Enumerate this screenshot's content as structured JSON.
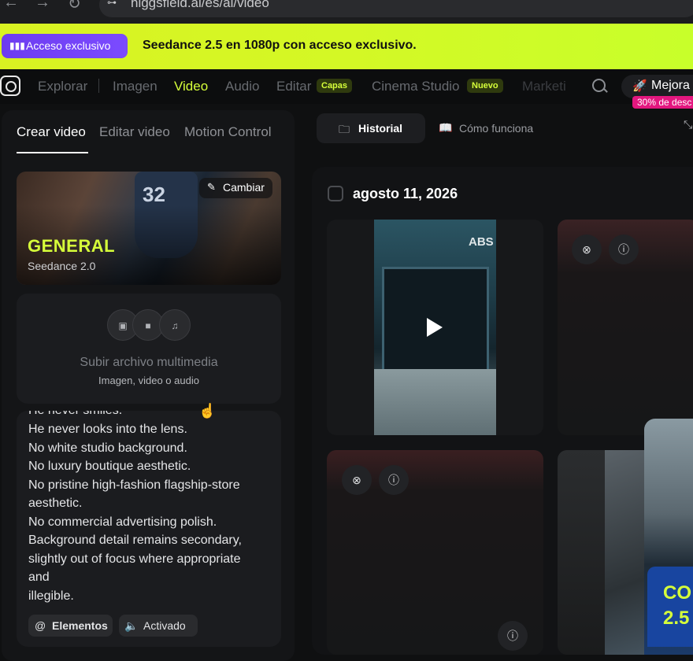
{
  "browser": {
    "back": "←",
    "forward": "→",
    "reload": "↻",
    "url": "higgsfield.ai/es/ai/video"
  },
  "promo": {
    "badge": "Acceso exclusivo",
    "text": "Seedance 2.5 en 1080p con acceso exclusivo."
  },
  "nav": {
    "items": [
      "Explorar",
      "Imagen",
      "Video",
      "Audio",
      "Editar",
      "Cinema Studio",
      "Marketi"
    ],
    "active": "Video",
    "tag_capas": "Capas",
    "tag_nuevo": "Nuevo",
    "upgrade": "Mejora",
    "discount": "30% de desc"
  },
  "left": {
    "tabs": [
      "Crear video",
      "Editar video",
      "Motion Control"
    ],
    "active_tab": "Crear video",
    "model": {
      "title": "GENERAL",
      "subtitle": "Seedance 2.0",
      "change": "Cambiar",
      "jersey": "32"
    },
    "upload": {
      "title": "Subir archivo multimedia",
      "subtitle": "Imagen, video o audio"
    },
    "prompt_lines": [
      "He never smiles.",
      "He never looks into the lens.",
      "No white studio background.",
      "No luxury boutique aesthetic.",
      "No pristine high-fashion flagship-store",
      "aesthetic.",
      "No commercial advertising polish.",
      "Background detail remains secondary,",
      "slightly out of focus where appropriate",
      "and",
      "illegible."
    ],
    "chips": {
      "elements": "Elementos",
      "audio": "Activado"
    }
  },
  "right": {
    "tabs": {
      "history": "Historial",
      "how": "Cómo funciona"
    },
    "date": "agosto 11, 2026",
    "storefront_sign": "ABS",
    "popup_text": [
      "CO",
      "2.5"
    ]
  },
  "colors": {
    "accent": "#d6ff3a",
    "promo_badge": "#7b4bff",
    "discount": "#e3177f"
  }
}
